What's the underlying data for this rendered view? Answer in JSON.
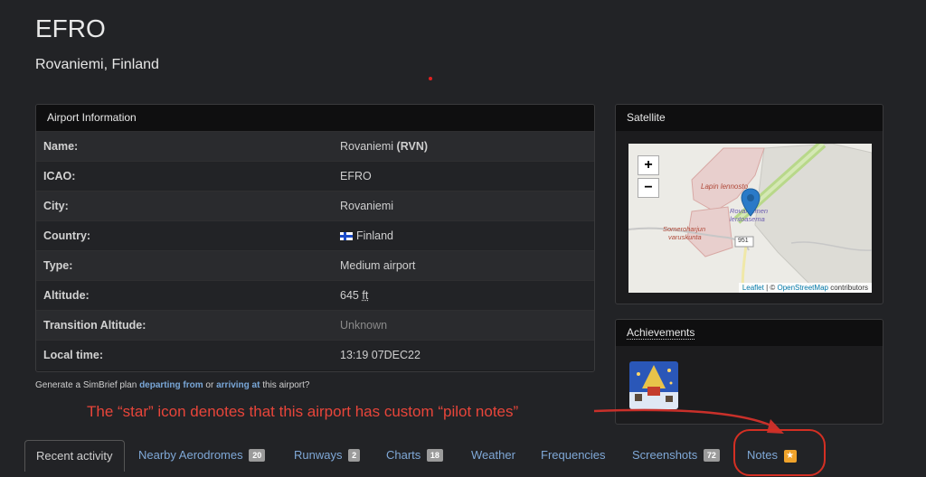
{
  "header": {
    "code": "EFRO",
    "location": "Rovaniemi, Finland"
  },
  "info": {
    "title": "Airport Information",
    "rows": [
      {
        "key": "Name:",
        "value": "Rovaniemi ",
        "extra": "(RVN)"
      },
      {
        "key": "ICAO:",
        "value": "EFRO"
      },
      {
        "key": "City:",
        "value": "Rovaniemi"
      },
      {
        "key": "Country:",
        "value": "Finland"
      },
      {
        "key": "Type:",
        "value": "Medium airport"
      },
      {
        "key": "Altitude:",
        "value": "645 ",
        "unit": "ft"
      },
      {
        "key": "Transition Altitude:",
        "value": "Unknown"
      },
      {
        "key": "Local time:",
        "value": "13:19 07DEC22"
      }
    ]
  },
  "simbrief": {
    "prefix": "Generate a SimBrief plan",
    "link1": "departing from",
    "middle": "or",
    "link2": "arriving at",
    "suffix": "this airport?"
  },
  "satellite": {
    "title": "Satellite",
    "zoom_in": "+",
    "zoom_out": "−",
    "labels": {
      "lapin": "Lapin lennosto",
      "terminal1": "Rovaniemen",
      "terminal2": "lentoasema",
      "someron1": "Someroharjun",
      "someron2": "varuskunta",
      "road": "951"
    },
    "attribution": {
      "leaflet": "Leaflet",
      "sep": " | © ",
      "osm": "OpenStreetMap",
      "rest": " contributors"
    }
  },
  "achievements": {
    "title": "Achievements"
  },
  "annotation": "The “star” icon denotes that this airport has custom “pilot notes”",
  "tabs": [
    {
      "label": "Recent activity",
      "badge": ""
    },
    {
      "label": "Nearby Aerodromes",
      "badge": "20"
    },
    {
      "label": "Runways",
      "badge": "2"
    },
    {
      "label": "Charts",
      "badge": "18"
    },
    {
      "label": "Weather",
      "badge": ""
    },
    {
      "label": "Frequencies",
      "badge": ""
    },
    {
      "label": "Screenshots",
      "badge": "72"
    },
    {
      "label": "Notes",
      "badge": "★"
    }
  ],
  "colors": {
    "background": "#222326",
    "link": "#7fa8d7",
    "annotation": "#e8453a",
    "star_badge": "#f0a32b"
  }
}
